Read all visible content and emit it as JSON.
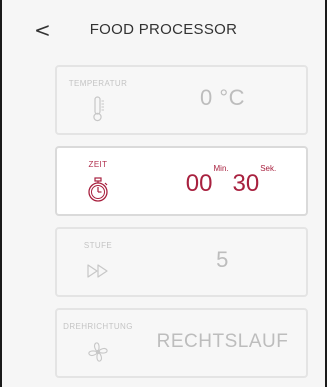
{
  "header": {
    "back_icon": "chevron-left-icon",
    "back_glyph": "<",
    "title": "FOOD PROCESSOR"
  },
  "cards": {
    "temperature": {
      "label": "TEMPERATUR",
      "icon": "thermometer-icon",
      "value": "0 °C"
    },
    "time": {
      "label": "ZEIT",
      "icon": "stopwatch-icon",
      "minutes": "00",
      "minutes_unit": "Min.",
      "seconds": "30",
      "seconds_unit": "Sek."
    },
    "speed": {
      "label": "STUFE",
      "icon": "double-play-icon",
      "value": "5"
    },
    "direction": {
      "label": "DREHRICHTUNG",
      "icon": "fan-icon",
      "value": "RECHTSLAUF"
    }
  },
  "colors": {
    "accent": "#a8213f",
    "inactive_text": "#bdbdbd",
    "card_border": "#e4e4e4"
  }
}
